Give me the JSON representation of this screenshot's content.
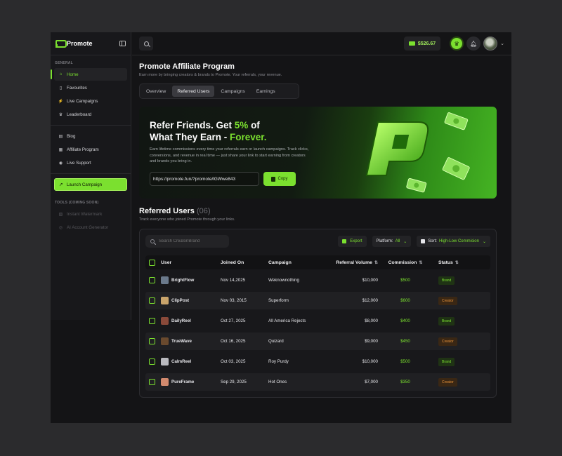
{
  "app": {
    "name": "Promote"
  },
  "sidebar": {
    "general_label": "GENERAL",
    "items": [
      {
        "label": "Home",
        "icon": "home-icon",
        "glyph": "⌂",
        "active": true
      },
      {
        "label": "Favourites",
        "icon": "bookmark-icon",
        "glyph": "▯"
      },
      {
        "label": "Live Campaigns",
        "icon": "lightning-icon",
        "glyph": "⚡"
      },
      {
        "label": "Leaderboard",
        "icon": "trophy-icon",
        "glyph": "♛"
      }
    ],
    "items2": [
      {
        "label": "Blog",
        "icon": "blog-icon",
        "glyph": "▤"
      },
      {
        "label": "Affiliate Program",
        "icon": "affiliate-icon",
        "glyph": "▦"
      },
      {
        "label": "Live Support",
        "icon": "support-icon",
        "glyph": "◉"
      }
    ],
    "launch_label": "Launch Campaign",
    "tools_label": "TOOLS (COMING SOON)",
    "tools": [
      {
        "label": "Instant Watermark",
        "icon": "watermark-icon",
        "glyph": "▧"
      },
      {
        "label": "AI Account Generator",
        "icon": "ai-icon",
        "glyph": "◎"
      }
    ]
  },
  "topbar": {
    "balance": "$526.67"
  },
  "page": {
    "title": "Promote Affiliate Program",
    "subtitle": "Earn more by bringing creators & brands to Promote. Your referrals, your revenue."
  },
  "tabs": [
    "Overview",
    "Referred Users",
    "Campaigns",
    "Earnings"
  ],
  "hero": {
    "title_a": "Refer Friends. Get ",
    "title_pct": "5%",
    "title_b": " of",
    "title_c": "What They Earn - ",
    "title_forever": "Forever.",
    "desc": "Earn lifetime commissions every time your referrals earn or launch campaigns. Track clicks, conversions, and revenue in real time — just share your link to start earning from creators and brands you bring in.",
    "link": "https://promote.fun/?promote/lGWwe843",
    "copy_label": "Copy"
  },
  "referred": {
    "title": "Referred Users",
    "count": "(06)",
    "subtitle": "Track everyone who joined Promote through your links.",
    "search_placeholder": "Search Creator/Brand",
    "export_label": "Export",
    "platform_label": "Platform:",
    "platform_value": "All",
    "sort_label": "Sort:",
    "sort_value": "High-Low Commision"
  },
  "table": {
    "headers": {
      "user": "User",
      "joined": "Joined On",
      "campaign": "Campaign",
      "volume": "Referral Volume",
      "commission": "Commission",
      "status": "Status"
    },
    "rows": [
      {
        "user": "BrightFlow",
        "joined": "Nov 14,2025",
        "campaign": "Weknownothing",
        "volume": "$10,000",
        "commission": "$500",
        "status": "Brand",
        "avatar_color": "#6b7a8c"
      },
      {
        "user": "ClipPost",
        "joined": "Nov 03, 2015",
        "campaign": "Superform",
        "volume": "$12,000",
        "commission": "$600",
        "status": "Creator",
        "avatar_color": "#c9a46b"
      },
      {
        "user": "DailyReel",
        "joined": "Oct 27, 2025",
        "campaign": "All America Rejects",
        "volume": "$8,000",
        "commission": "$400",
        "status": "Brand",
        "avatar_color": "#8a4a3a"
      },
      {
        "user": "TrueWave",
        "joined": "Oct 16, 2025",
        "campaign": "Quizard",
        "volume": "$9,000",
        "commission": "$450",
        "status": "Creator",
        "avatar_color": "#6a4a2e"
      },
      {
        "user": "CalmReel",
        "joined": "Oct 03, 2025",
        "campaign": "Roy Purdy",
        "volume": "$10,000",
        "commission": "$500",
        "status": "Brand",
        "avatar_color": "#b9b9be"
      },
      {
        "user": "PureFrame",
        "joined": "Sep 29, 2025",
        "campaign": "Hot Ones",
        "volume": "$7,000",
        "commission": "$350",
        "status": "Creator",
        "avatar_color": "#d28a6e"
      }
    ]
  },
  "colors": {
    "accent": "#7be02f",
    "creator": "#e7923a"
  }
}
